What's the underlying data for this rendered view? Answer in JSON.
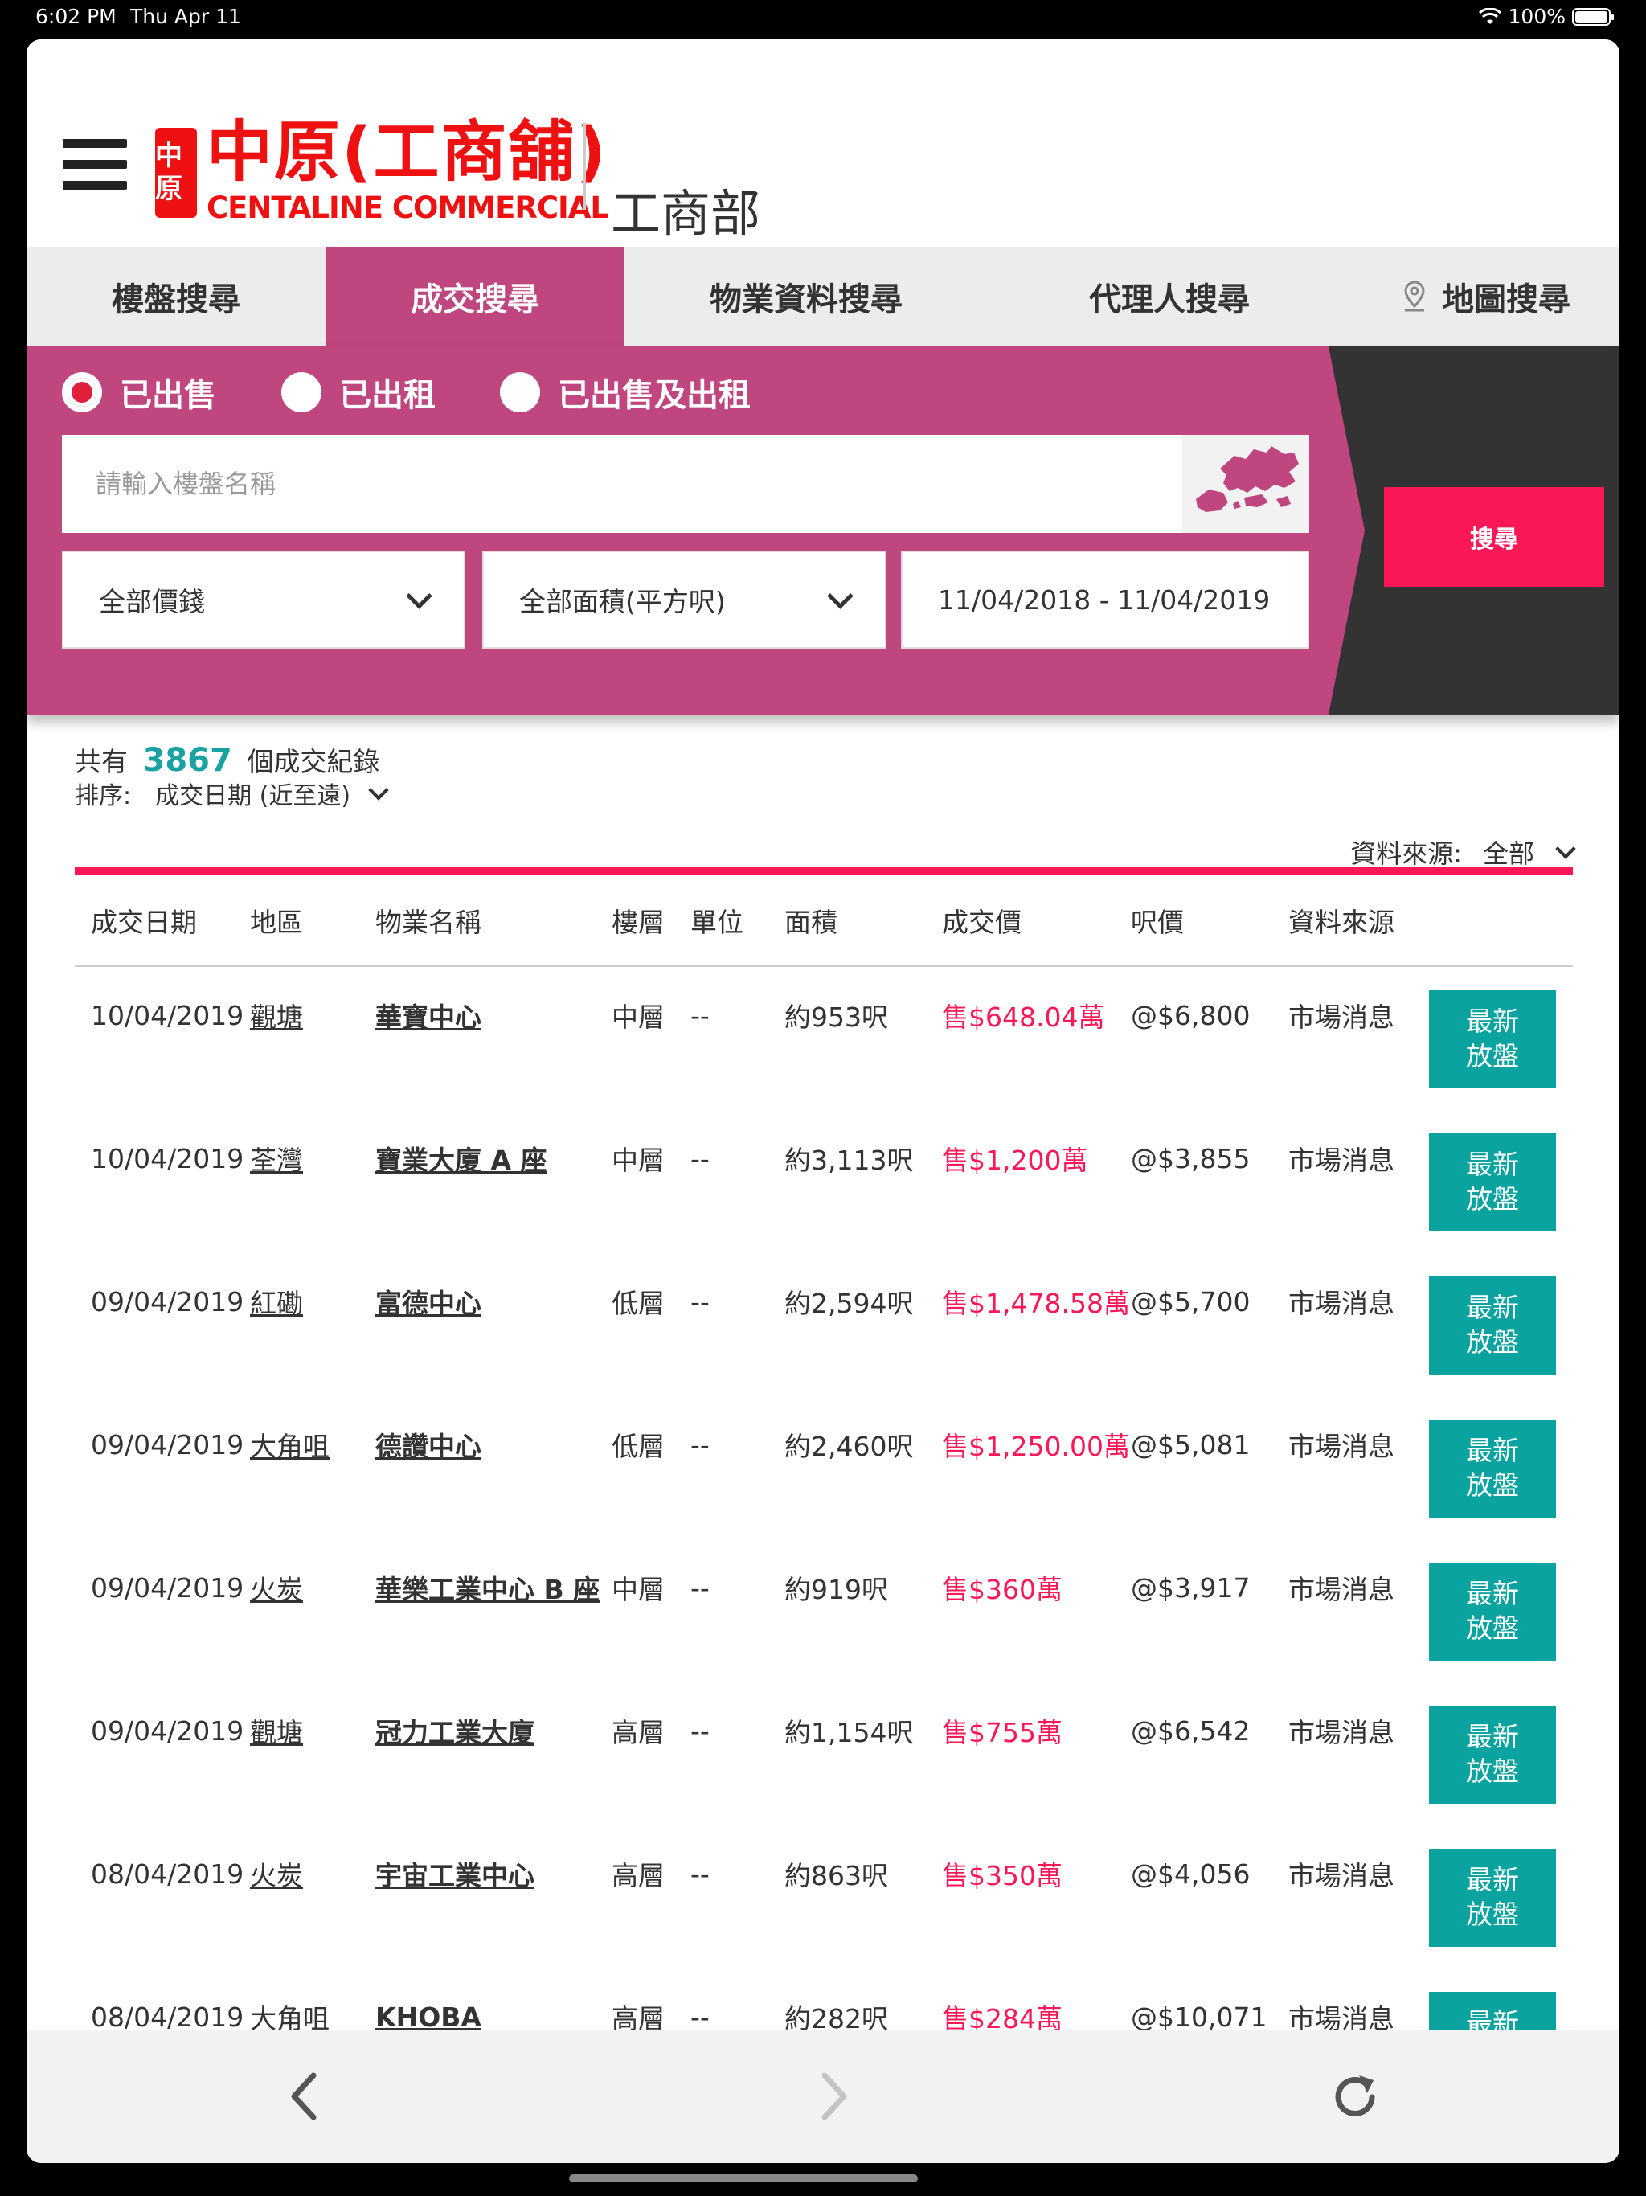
{
  "status": {
    "time": "6:02 PM",
    "date": "Thu Apr 11",
    "battery": "100%"
  },
  "header": {
    "logo_zh": "中原(工商舖)",
    "logo_en": "CENTALINE COMMERCIAL",
    "logo_seal": "中原",
    "dept": "工商部"
  },
  "tabs": [
    {
      "label": "樓盤搜尋"
    },
    {
      "label": "成交搜尋"
    },
    {
      "label": "物業資料搜尋"
    },
    {
      "label": "代理人搜尋"
    },
    {
      "label": "地圖搜尋"
    }
  ],
  "search": {
    "radios": [
      {
        "label": "已出售",
        "checked": true
      },
      {
        "label": "已出租",
        "checked": false
      },
      {
        "label": "已出售及出租",
        "checked": false
      }
    ],
    "placeholder": "請輸入樓盤名稱",
    "price": "全部價錢",
    "area": "全部面積(平方呎)",
    "date_range": "11/04/2018 - 11/04/2019",
    "button": "搜尋"
  },
  "summary": {
    "prefix": "共有",
    "count": "3867",
    "suffix": "個成交紀錄",
    "sort_label": "排序:",
    "sort_value": "成交日期 (近至遠)",
    "source_label": "資料來源:",
    "source_value": "全部"
  },
  "table": {
    "headers": [
      "成交日期",
      "地區",
      "物業名稱",
      "樓層",
      "單位",
      "面積",
      "成交價",
      "呎價",
      "資料來源"
    ],
    "button_line1": "最新",
    "button_line2": "放盤",
    "rows": [
      {
        "date": "10/04/2019",
        "district": "觀塘",
        "name": "華寶中心",
        "floor": "中層",
        "unit": "--",
        "area": "約953呎",
        "price": "售$648.04萬",
        "ppsf": "@$6,800",
        "source": "市場消息"
      },
      {
        "date": "10/04/2019",
        "district": "荃灣",
        "name": "寶業大廈 A 座",
        "floor": "中層",
        "unit": "--",
        "area": "約3,113呎",
        "price": "售$1,200萬",
        "ppsf": "@$3,855",
        "source": "市場消息"
      },
      {
        "date": "09/04/2019",
        "district": "紅磡",
        "name": "富德中心",
        "floor": "低層",
        "unit": "--",
        "area": "約2,594呎",
        "price": "售$1,478.58萬",
        "ppsf": "@$5,700",
        "source": "市場消息"
      },
      {
        "date": "09/04/2019",
        "district": "大角咀",
        "name": "德讚中心",
        "floor": "低層",
        "unit": "--",
        "area": "約2,460呎",
        "price": "售$1,250.00萬",
        "ppsf": "@$5,081",
        "source": "市場消息"
      },
      {
        "date": "09/04/2019",
        "district": "火炭",
        "name": "華樂工業中心 B 座",
        "floor": "中層",
        "unit": "--",
        "area": "約919呎",
        "price": "售$360萬",
        "ppsf": "@$3,917",
        "source": "市場消息"
      },
      {
        "date": "09/04/2019",
        "district": "觀塘",
        "name": "冠力工業大廈",
        "floor": "高層",
        "unit": "--",
        "area": "約1,154呎",
        "price": "售$755萬",
        "ppsf": "@$6,542",
        "source": "市場消息"
      },
      {
        "date": "08/04/2019",
        "district": "火炭",
        "name": "宇宙工業中心",
        "floor": "高層",
        "unit": "--",
        "area": "約863呎",
        "price": "售$350萬",
        "ppsf": "@$4,056",
        "source": "市場消息"
      },
      {
        "date": "08/04/2019",
        "district": "大角咀",
        "name": "KHOBA",
        "floor": "高層",
        "unit": "--",
        "area": "約282呎",
        "price": "售$284萬",
        "ppsf": "@$10,071",
        "source": "市場消息"
      }
    ]
  },
  "colors": {
    "brand": "#c0467f",
    "accent": "#fc1756",
    "teal": "#0aa39f",
    "logo_red": "#e11111"
  }
}
